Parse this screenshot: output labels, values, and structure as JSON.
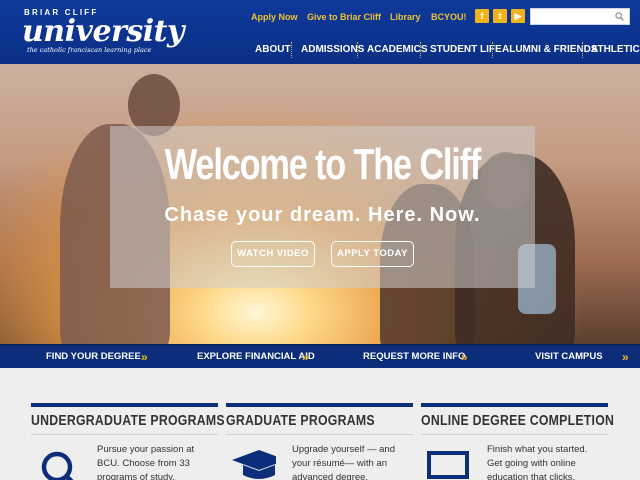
{
  "header": {
    "logo": {
      "top_text": "BRIAR CLIFF",
      "main_text": "university",
      "tagline": "the catholic franciscan learning place"
    },
    "utility_links": [
      "Apply Now",
      "Give to Briar Cliff",
      "Library",
      "BCYOU!"
    ],
    "social": [
      "facebook-icon",
      "twitter-icon",
      "youtube-icon"
    ],
    "search": {
      "placeholder": "",
      "value": ""
    },
    "nav": [
      "ABOUT",
      "ADMISSIONS",
      "ACADEMICS",
      "STUDENT LIFE",
      "ALUMNI & FRIENDS",
      "ATHLETICS"
    ],
    "accent_color": "#f1c232"
  },
  "hero": {
    "title": "Welcome to The Cliff",
    "subtitle": "Chase your dream. Here. Now.",
    "buttons": [
      "WATCH VIDEO",
      "APPLY TODAY"
    ]
  },
  "quick_links": [
    "FIND YOUR DEGREE",
    "EXPLORE FINANCIAL AID",
    "REQUEST MORE INFO",
    "VISIT CAMPUS"
  ],
  "programs": [
    {
      "title": "UNDERGRADUATE PROGRAMS",
      "text": "Pursue your passion at BCU. Choose from 33 programs of study.",
      "icon": "magnifier-icon"
    },
    {
      "title": "GRADUATE PROGRAMS",
      "text": "Upgrade yourself — and your résumé— with an advanced degree.",
      "icon": "graduation-cap-icon"
    },
    {
      "title": "ONLINE DEGREE COMPLETION",
      "text": "Finish what you started. Get going with online education that clicks.",
      "icon": "laptop-icon"
    }
  ],
  "colors": {
    "navy": "#0b2d7a",
    "header_blue": "#0f3a9a",
    "gold": "#f1b81c"
  }
}
